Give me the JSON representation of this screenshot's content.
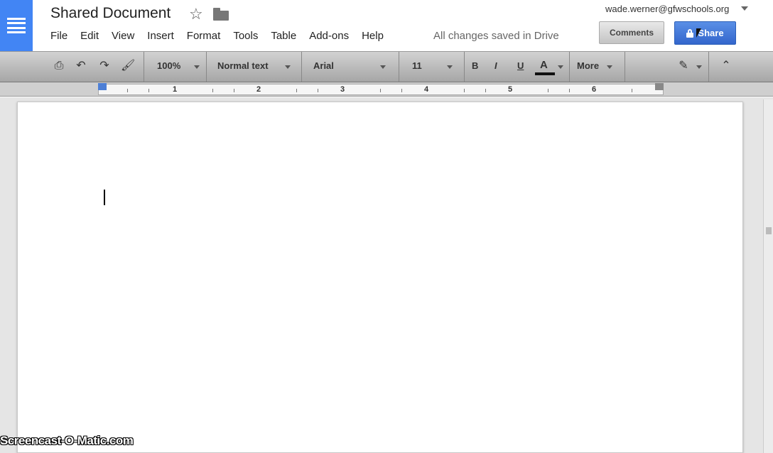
{
  "header": {
    "title": "Shared Document",
    "account": "wade.werner@gfwschools.org",
    "save_status": "All changes saved in Drive",
    "comments_label": "Comments",
    "share_label": "Share",
    "share_color": "#3b78e7"
  },
  "menu": [
    "File",
    "Edit",
    "View",
    "Insert",
    "Format",
    "Tools",
    "Table",
    "Add-ons",
    "Help"
  ],
  "toolbar": {
    "zoom": "100%",
    "style": "Normal text",
    "font": "Arial",
    "font_size": "11",
    "bold": "B",
    "italic": "I",
    "underline": "U",
    "text_color": "A",
    "more": "More"
  },
  "ruler": {
    "numbers": [
      "1",
      "2",
      "3",
      "4",
      "5",
      "6"
    ]
  },
  "watermark": "Screencast-O-Matic.com"
}
